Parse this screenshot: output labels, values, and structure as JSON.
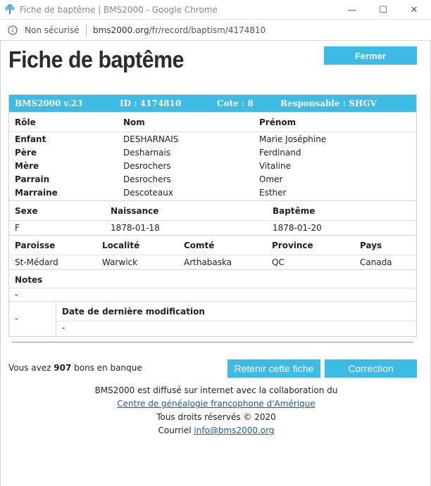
{
  "window": {
    "title": "Fiche de baptême | BMS2000 - Google Chrome",
    "minimize_glyph": "—",
    "maximize_glyph": "☐",
    "close_glyph": "✕"
  },
  "address": {
    "security_text": "Non sécurisé",
    "url_host": "bms2000.org",
    "url_path": "/fr/record/baptism/4174810"
  },
  "page": {
    "title": "Fiche de baptême",
    "close_button": "Fermer"
  },
  "record": {
    "header": {
      "version": "BMS2000 v.23",
      "id": "ID : 4174810",
      "cote": "Cote : 8",
      "responsable": "Responsable : SHGV"
    },
    "people": {
      "columns": [
        "Rôle",
        "Nom",
        "Prénom"
      ],
      "rows": [
        {
          "role": "Enfant",
          "nom": "DESHARNAIS",
          "prenom": "Marie Joséphine"
        },
        {
          "role": "Père",
          "nom": "Desharnais",
          "prenom": "Ferdinand"
        },
        {
          "role": "Mère",
          "nom": "Desrochers",
          "prenom": "Vitaline"
        },
        {
          "role": "Parrain",
          "nom": "Desrochers",
          "prenom": "Omer"
        },
        {
          "role": "Marraine",
          "nom": "Descoteaux",
          "prenom": "Esther"
        }
      ]
    },
    "vital": {
      "columns": [
        "Sexe",
        "Naissance",
        "Baptême"
      ],
      "values": [
        "F",
        "1878-01-18",
        "1878-01-20"
      ]
    },
    "location": {
      "columns": [
        "Paroisse",
        "Localité",
        "Comté",
        "Province",
        "Pays"
      ],
      "values": [
        "St-Médard",
        "Warwick",
        "Arthabaska",
        "QC",
        "Canada"
      ]
    },
    "notes": {
      "label": "Notes",
      "value": "-"
    },
    "modification": {
      "left_value": "-",
      "label": "Date de dernière modification",
      "value": "-"
    }
  },
  "bank": {
    "prefix": "Vous avez ",
    "count": "907",
    "suffix": " bons en banque"
  },
  "actions": {
    "keep": "Retenir cette fiche",
    "correction": "Correction"
  },
  "footer": {
    "line1": "BMS2000 est diffusé sur internet avec la collaboration du",
    "link1": "Centre de généalogie francophone d'Amérique",
    "line3": "Tous droits réservés © 2020",
    "line4_prefix": "Courriel ",
    "email": "info@bms2000.org"
  },
  "colors": {
    "accent": "#3bbbe6",
    "link": "#1a5a9a"
  }
}
